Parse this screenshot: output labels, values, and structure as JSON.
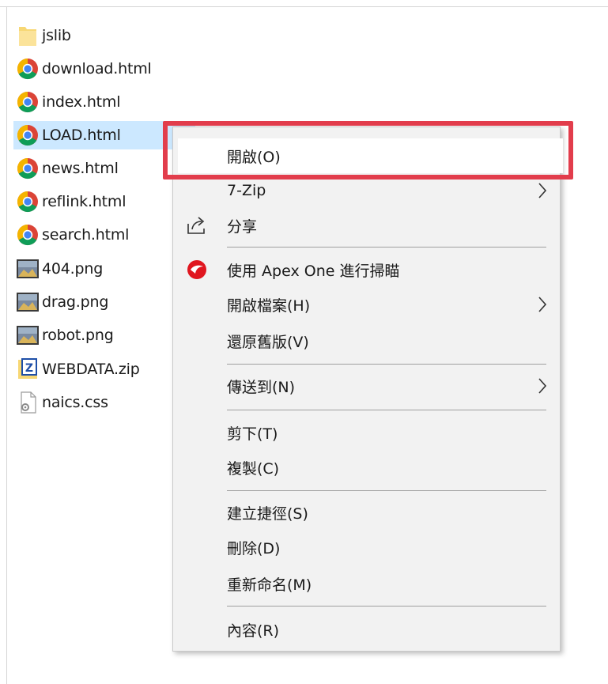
{
  "files": [
    {
      "name": "jslib",
      "icon": "folder-icon"
    },
    {
      "name": "download.html",
      "icon": "chrome-icon"
    },
    {
      "name": "index.html",
      "icon": "chrome-icon"
    },
    {
      "name": "LOAD.html",
      "icon": "chrome-icon",
      "selected": true
    },
    {
      "name": "news.html",
      "icon": "chrome-icon"
    },
    {
      "name": "reflink.html",
      "icon": "chrome-icon"
    },
    {
      "name": "search.html",
      "icon": "chrome-icon"
    },
    {
      "name": "404.png",
      "icon": "image-icon"
    },
    {
      "name": "drag.png",
      "icon": "image-icon"
    },
    {
      "name": "robot.png",
      "icon": "image-icon"
    },
    {
      "name": "WEBDATA.zip",
      "icon": "zip-icon"
    },
    {
      "name": "naics.css",
      "icon": "css-file-icon"
    }
  ],
  "context_menu": {
    "open": "開啟(O)",
    "seven_zip": "7-Zip",
    "share": "分享",
    "scan": "使用 Apex One 進行掃瞄",
    "open_archive": "開啟檔案(H)",
    "restore_previous": "還原舊版(V)",
    "send_to": "傳送到(N)",
    "cut": "剪下(T)",
    "copy": "複製(C)",
    "create_shortcut": "建立捷徑(S)",
    "delete": "刪除(D)",
    "rename": "重新命名(M)",
    "properties": "內容(R)"
  },
  "colors": {
    "selection": "#cce8ff",
    "menu_background": "#f2f2f2",
    "callout": "#e23d4c"
  }
}
